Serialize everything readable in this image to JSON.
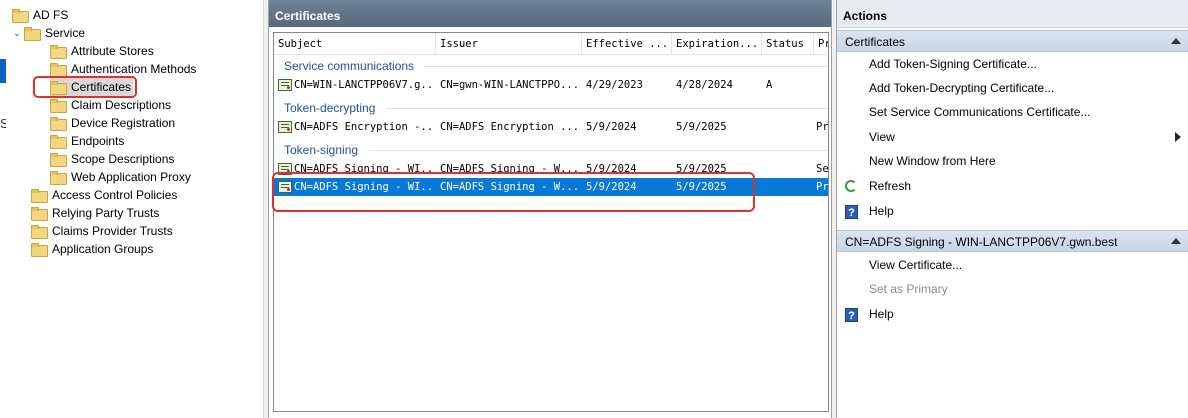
{
  "edge_char": "S",
  "tree": {
    "items": [
      {
        "label": "AD FS",
        "level": 0,
        "chevron": ""
      },
      {
        "label": "Service",
        "level": 1,
        "chevron": "⌄"
      },
      {
        "label": "Attribute Stores",
        "level": 2,
        "chevron": ""
      },
      {
        "label": "Authentication Methods",
        "level": 2,
        "chevron": ""
      },
      {
        "label": "Certificates",
        "level": 2,
        "chevron": "",
        "selected": true
      },
      {
        "label": "Claim Descriptions",
        "level": 2,
        "chevron": ""
      },
      {
        "label": "Device Registration",
        "level": 2,
        "chevron": ""
      },
      {
        "label": "Endpoints",
        "level": 2,
        "chevron": ""
      },
      {
        "label": "Scope Descriptions",
        "level": 2,
        "chevron": ""
      },
      {
        "label": "Web Application Proxy",
        "level": 2,
        "chevron": ""
      },
      {
        "label": "Access Control Policies",
        "level": 1,
        "chevron": ""
      },
      {
        "label": "Relying Party Trusts",
        "level": 1,
        "chevron": ""
      },
      {
        "label": "Claims Provider Trusts",
        "level": 1,
        "chevron": ""
      },
      {
        "label": "Application Groups",
        "level": 1,
        "chevron": ""
      }
    ]
  },
  "center": {
    "title": "Certificates",
    "columns": [
      "Subject",
      "Issuer",
      "Effective ...",
      "Expiration...",
      "Status",
      "Pr"
    ],
    "groups": [
      {
        "label": "Service communications",
        "rows": [
          {
            "subject": "CN=WIN-LANCTPP06V7.g...",
            "issuer": "CN=gwn-WIN-LANCTPPO...",
            "effective": "4/29/2023",
            "expiration": "4/28/2024",
            "status": "A",
            "primary": ""
          }
        ]
      },
      {
        "label": "Token-decrypting",
        "rows": [
          {
            "subject": "CN=ADFS Encryption -...",
            "issuer": "CN=ADFS Encryption ...",
            "effective": "5/9/2024",
            "expiration": "5/9/2025",
            "status": "",
            "primary": "Pr"
          }
        ]
      },
      {
        "label": "Token-signing",
        "rows": [
          {
            "subject": "CN=ADFS Signing - WI...",
            "issuer": "CN=ADFS Signing - W...",
            "effective": "5/9/2024",
            "expiration": "5/9/2025",
            "status": "",
            "primary": "Se"
          },
          {
            "subject": "CN=ADFS Signing - WI...",
            "issuer": "CN=ADFS Signing - W...",
            "effective": "5/9/2024",
            "expiration": "5/9/2025",
            "status": "",
            "primary": "Pr",
            "selected": true
          }
        ]
      }
    ]
  },
  "actions": {
    "title": "Actions",
    "sections": [
      {
        "header": "Certificates",
        "items": [
          {
            "label": "Add Token-Signing Certificate...",
            "icon": ""
          },
          {
            "label": "Add Token-Decrypting Certificate...",
            "icon": ""
          },
          {
            "label": "Set Service Communications Certificate...",
            "icon": ""
          },
          {
            "label": "View",
            "icon": "",
            "submenu": true
          },
          {
            "label": "New Window from Here",
            "icon": ""
          },
          {
            "label": "Refresh",
            "icon": "refresh-icon"
          },
          {
            "label": "Help",
            "icon": "help-icon"
          }
        ]
      },
      {
        "header": "CN=ADFS Signing - WIN-LANCTPP06V7.gwn.best",
        "items": [
          {
            "label": "View Certificate...",
            "icon": ""
          },
          {
            "label": "Set as Primary",
            "icon": "",
            "disabled": true
          },
          {
            "label": "Help",
            "icon": "help-icon"
          }
        ]
      }
    ],
    "help_glyph": "?"
  },
  "colors": {
    "selection": "#0a78d7",
    "group_header": "#1e50a2",
    "highlight_outline": "#e0302d",
    "pane_title": "#56697d"
  }
}
